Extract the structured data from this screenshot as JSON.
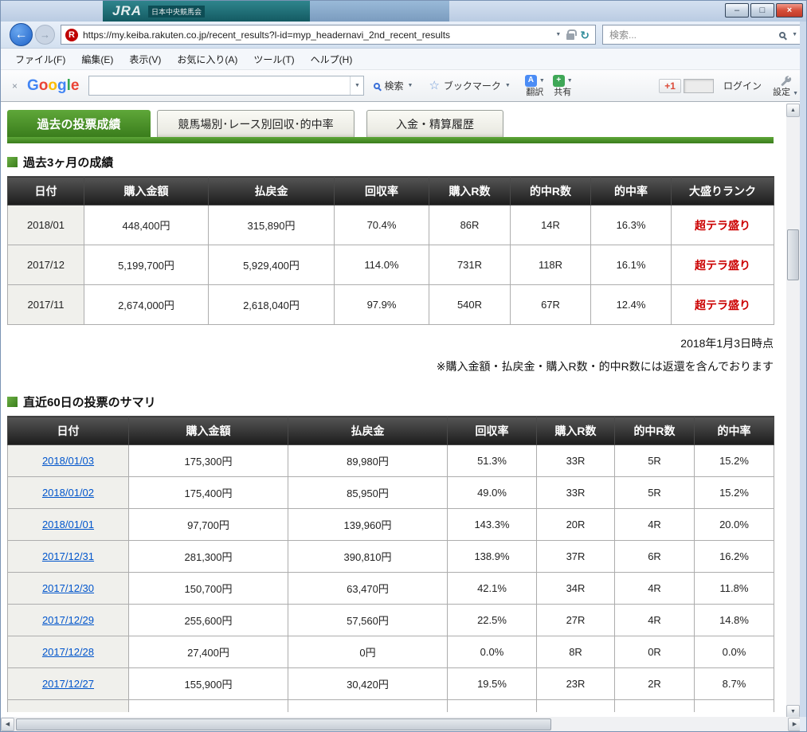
{
  "titlebar": {
    "jra_logo": "JRA",
    "jra_sub": "日本中央競馬会"
  },
  "icons": {
    "back": "←",
    "forward": "→",
    "dropdown": "▼",
    "refresh": "↻",
    "minimize": "–",
    "maximize": "□",
    "close": "×",
    "close_small": "×",
    "up": "▲",
    "down": "▼",
    "left": "◀",
    "right": "▶",
    "star": "☆",
    "translate_glyph": "A",
    "share_glyph": "+"
  },
  "browser": {
    "url": "https://my.keiba.rakuten.co.jp/recent_results?l-id=myp_headernavi_2nd_recent_results",
    "favicon_letter": "R",
    "search_placeholder": "検索...",
    "menu_items": [
      "ファイル(F)",
      "編集(E)",
      "表示(V)",
      "お気に入り(A)",
      "ツール(T)",
      "ヘルプ(H)"
    ]
  },
  "toolbar": {
    "logo_letters": [
      "G",
      "o",
      "o",
      "g",
      "l",
      "e"
    ],
    "logo_colors": [
      "#4285f4",
      "#ea4335",
      "#fbbc05",
      "#4285f4",
      "#34a853",
      "#ea4335"
    ],
    "search_label": "検索",
    "bookmarks_label": "ブックマーク",
    "translate_label": "翻訳",
    "share_label": "共有",
    "plusone_label": "+1",
    "login_label": "ログイン",
    "settings_label": "設定"
  },
  "page": {
    "tabs": [
      {
        "label": "過去の投票成績",
        "active": true
      },
      {
        "label": "競馬場別･レース別回収･的中率",
        "active": false
      },
      {
        "label": "入金・精算履歴",
        "active": false
      }
    ],
    "section1": {
      "title": "過去3ヶ月の成績",
      "headers": [
        "日付",
        "購入金額",
        "払戻金",
        "回収率",
        "購入R数",
        "的中R数",
        "的中率",
        "大盛りランク"
      ],
      "rows": [
        [
          "2018/01",
          "448,400円",
          "315,890円",
          "70.4%",
          "86R",
          "14R",
          "16.3%",
          "超テラ盛り"
        ],
        [
          "2017/12",
          "5,199,700円",
          "5,929,400円",
          "114.0%",
          "731R",
          "118R",
          "16.1%",
          "超テラ盛り"
        ],
        [
          "2017/11",
          "2,674,000円",
          "2,618,040円",
          "97.9%",
          "540R",
          "67R",
          "12.4%",
          "超テラ盛り"
        ]
      ],
      "as_of": "2018年1月3日時点",
      "note": "※購入金額・払戻金・購入R数・的中R数には返還を含んでおります"
    },
    "section2": {
      "title": "直近60日の投票のサマリ",
      "headers": [
        "日付",
        "購入金額",
        "払戻金",
        "回収率",
        "購入R数",
        "的中R数",
        "的中率"
      ],
      "rows": [
        [
          "2018/01/03",
          "175,300円",
          "89,980円",
          "51.3%",
          "33R",
          "5R",
          "15.2%"
        ],
        [
          "2018/01/02",
          "175,400円",
          "85,950円",
          "49.0%",
          "33R",
          "5R",
          "15.2%"
        ],
        [
          "2018/01/01",
          "97,700円",
          "139,960円",
          "143.3%",
          "20R",
          "4R",
          "20.0%"
        ],
        [
          "2017/12/31",
          "281,300円",
          "390,810円",
          "138.9%",
          "37R",
          "6R",
          "16.2%"
        ],
        [
          "2017/12/30",
          "150,700円",
          "63,470円",
          "42.1%",
          "34R",
          "4R",
          "11.8%"
        ],
        [
          "2017/12/29",
          "255,600円",
          "57,560円",
          "22.5%",
          "27R",
          "4R",
          "14.8%"
        ],
        [
          "2017/12/28",
          "27,400円",
          "0円",
          "0.0%",
          "8R",
          "0R",
          "0.0%"
        ],
        [
          "2017/12/27",
          "155,900円",
          "30,420円",
          "19.5%",
          "23R",
          "2R",
          "8.7%"
        ]
      ]
    }
  },
  "colors": {
    "accent_green_light": "#5fa739",
    "accent_green_dark": "#3a7d1c",
    "link_blue": "#0055cc",
    "rank_red": "#cc0000",
    "rakuten_red": "#bf0000"
  }
}
